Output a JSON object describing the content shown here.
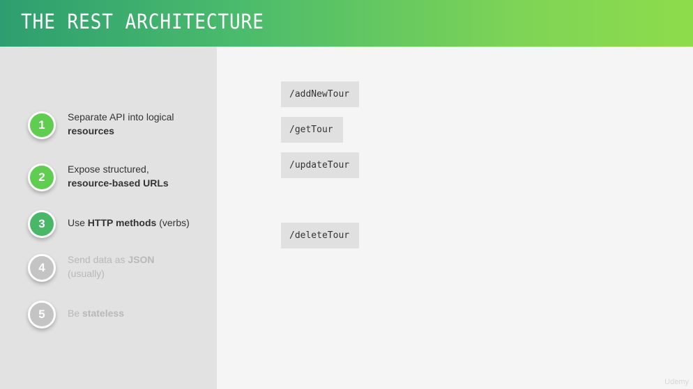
{
  "header": {
    "title": "THE REST ARCHITECTURE",
    "gradient": [
      "#2e9e70",
      "#8edc4c"
    ]
  },
  "steps": [
    {
      "number": "1",
      "text": "Separate API into logical",
      "bold": "resources",
      "state": "active"
    },
    {
      "number": "2",
      "text": "Expose structured,",
      "bold": "resource-based URLs",
      "state": "active"
    },
    {
      "number": "3",
      "prefix": "Use ",
      "bold": "HTTP methods",
      "suffix": " (verbs)",
      "state": "current"
    },
    {
      "number": "4",
      "prefix": "Send data as ",
      "bold": "JSON",
      "line2": "(usually)",
      "state": "dim"
    },
    {
      "number": "5",
      "prefix": "Be ",
      "bold": "stateless",
      "state": "dim"
    }
  ],
  "endpoints": [
    "/addNewTour",
    "/getTour",
    "/updateTour",
    "/deleteTour"
  ],
  "watermark": "Udemy",
  "colors": {
    "active_step": "#5fcd4f",
    "current_step": "#48b768",
    "dim_step": "#c4c4c4",
    "left_panel": "#e2e2e2",
    "endpoint_bg": "#e0e0e0"
  }
}
